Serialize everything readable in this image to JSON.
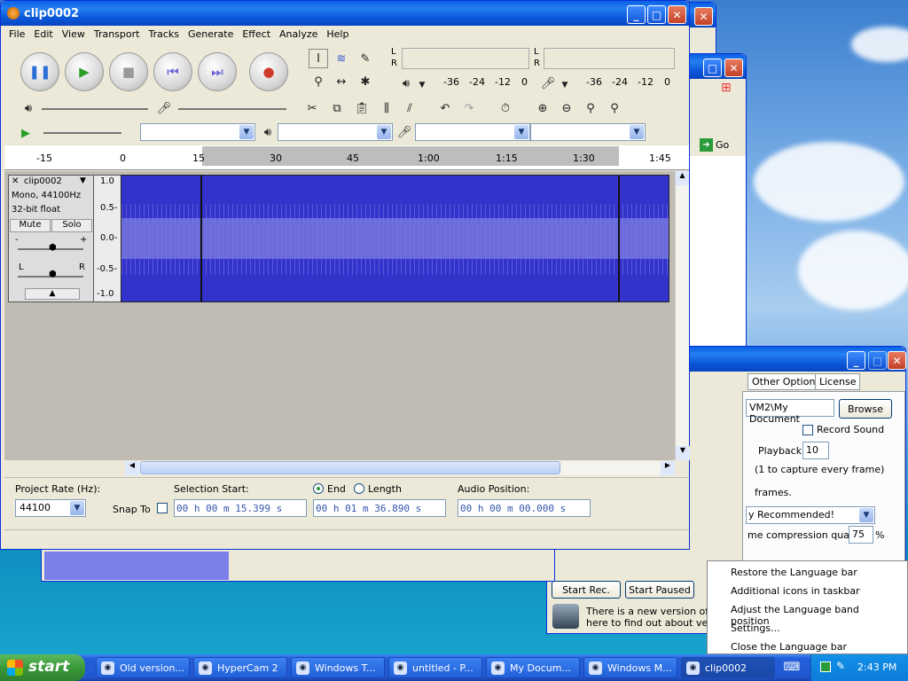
{
  "audacity": {
    "title": "clip0002",
    "menus": [
      "File",
      "Edit",
      "View",
      "Transport",
      "Tracks",
      "Generate",
      "Effect",
      "Analyze",
      "Help"
    ],
    "meter_left_labels": [
      "L",
      "R"
    ],
    "meter_right_labels": [
      "L",
      "R"
    ],
    "meter_ticks_play": [
      "-36",
      "-24",
      "-12",
      "0"
    ],
    "meter_ticks_rec": [
      "-36",
      "-24",
      "-12",
      "0"
    ],
    "timeline_labels": [
      "-15",
      "0",
      "15",
      "30",
      "45",
      "1:00",
      "1:15",
      "1:30",
      "1:45"
    ],
    "track": {
      "name": "clip0002",
      "info1": "Mono, 44100Hz",
      "info2": "32-bit float",
      "mute": "Mute",
      "solo": "Solo",
      "gain_minus": "-",
      "gain_plus": "+",
      "pan_left": "L",
      "pan_right": "R",
      "scale": [
        "1.0",
        "0.5-",
        "0.0-",
        "-0.5-",
        "-1.0"
      ]
    },
    "bottom": {
      "project_rate_label": "Project Rate (Hz):",
      "project_rate_value": "44100",
      "snap_label": "Snap To",
      "selection_start_label": "Selection Start:",
      "end_label": "End",
      "length_label": "Length",
      "selection_start_value": "00 h 00 m 15.399 s",
      "selection_end_value": "00 h 01 m 36.890 s",
      "audio_position_label": "Audio Position:",
      "audio_position_value": "00 h 00 m 00.000 s"
    }
  },
  "bg_window": {
    "go_label": "Go"
  },
  "hypercam": {
    "tabs": [
      "Other Options",
      "License"
    ],
    "path_value": "VM2\\My Document",
    "browse": "Browse",
    "record_sound": "Record Sound",
    "playback_label": "Playback:",
    "playback_value": "10",
    "capture_hint": "(1 to capture every frame)",
    "frames_label": "frames.",
    "recommended": "y Recommended!",
    "compression_label": "me compression quality",
    "compression_value": "75",
    "percent": "%",
    "start_rec": "Start Rec.",
    "start_paused": "Start Paused",
    "update_line1": "There is a new version of Hyp",
    "update_line2": "here to find out about versio"
  },
  "context_menu": {
    "items": [
      "Restore the Language bar",
      "Additional icons in taskbar",
      "Adjust the Language band position",
      "Settings...",
      "Close the Language bar"
    ]
  },
  "taskbar": {
    "start": "start",
    "items": [
      "Old version...",
      "HyperCam 2",
      "Windows T...",
      "untitled - P...",
      "My Docum...",
      "Windows M...",
      "clip0002"
    ],
    "clock": "2:43 PM"
  }
}
